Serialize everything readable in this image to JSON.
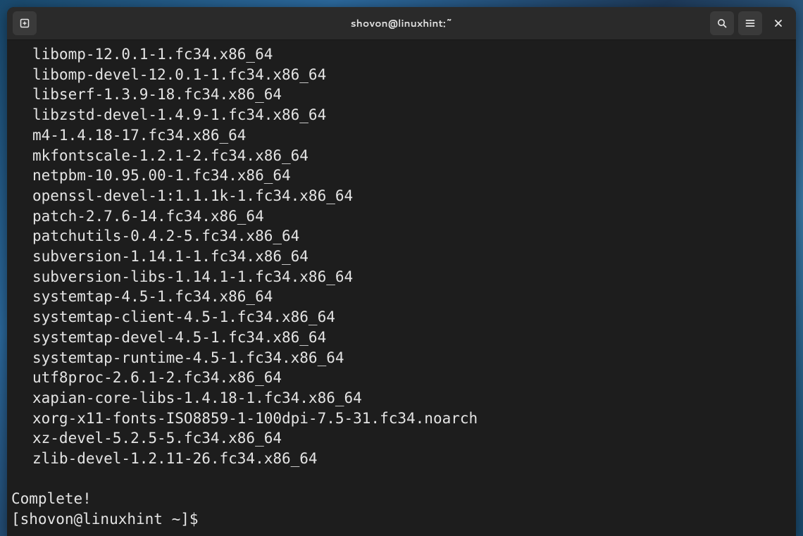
{
  "window": {
    "title": "shovon@linuxhint:~"
  },
  "packages": [
    "libomp-12.0.1-1.fc34.x86_64",
    "libomp-devel-12.0.1-1.fc34.x86_64",
    "libserf-1.3.9-18.fc34.x86_64",
    "libzstd-devel-1.4.9-1.fc34.x86_64",
    "m4-1.4.18-17.fc34.x86_64",
    "mkfontscale-1.2.1-2.fc34.x86_64",
    "netpbm-10.95.00-1.fc34.x86_64",
    "openssl-devel-1:1.1.1k-1.fc34.x86_64",
    "patch-2.7.6-14.fc34.x86_64",
    "patchutils-0.4.2-5.fc34.x86_64",
    "subversion-1.14.1-1.fc34.x86_64",
    "subversion-libs-1.14.1-1.fc34.x86_64",
    "systemtap-4.5-1.fc34.x86_64",
    "systemtap-client-4.5-1.fc34.x86_64",
    "systemtap-devel-4.5-1.fc34.x86_64",
    "systemtap-runtime-4.5-1.fc34.x86_64",
    "utf8proc-2.6.1-2.fc34.x86_64",
    "xapian-core-libs-1.4.18-1.fc34.x86_64",
    "xorg-x11-fonts-ISO8859-1-100dpi-7.5-31.fc34.noarch",
    "xz-devel-5.2.5-5.fc34.x86_64",
    "zlib-devel-1.2.11-26.fc34.x86_64"
  ],
  "status": "Complete!",
  "prompt": "[shovon@linuxhint ~]$ ",
  "icons": {
    "new_tab": "new-tab-icon",
    "search": "search-icon",
    "menu": "hamburger-icon",
    "close": "close-icon"
  }
}
